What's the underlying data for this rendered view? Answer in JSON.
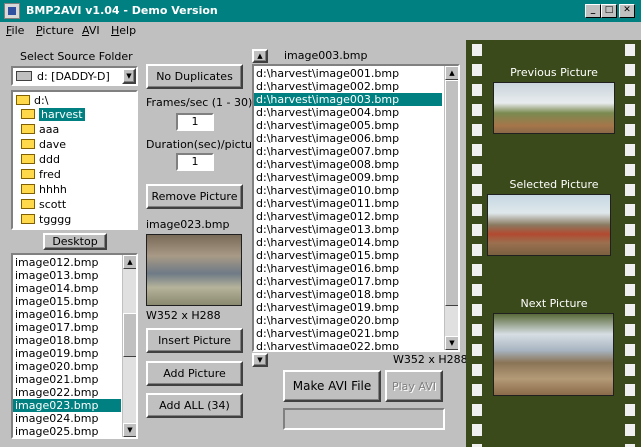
{
  "window": {
    "title": "BMP2AVI v1.04 - Demo Version",
    "min": "_",
    "max": "□",
    "close": "✕"
  },
  "menu": [
    "File",
    "Picture",
    "AVI",
    "Help"
  ],
  "source": {
    "label": "Select Source Folder",
    "drive": "d: [DADDY-D]",
    "tree": [
      {
        "name": "d:\\",
        "level": 0,
        "selected": false,
        "open": true
      },
      {
        "name": "harvest",
        "level": 1,
        "selected": true,
        "open": true
      },
      {
        "name": "aaa",
        "level": 1,
        "selected": false
      },
      {
        "name": "dave",
        "level": 1,
        "selected": false
      },
      {
        "name": "ddd",
        "level": 1,
        "selected": false
      },
      {
        "name": "fred",
        "level": 1,
        "selected": false
      },
      {
        "name": "hhhh",
        "level": 1,
        "selected": false
      },
      {
        "name": "scott",
        "level": 1,
        "selected": false
      },
      {
        "name": "tgggg",
        "level": 1,
        "selected": false
      }
    ],
    "desktop_label": "Desktop",
    "files": [
      "image012.bmp",
      "image013.bmp",
      "image014.bmp",
      "image015.bmp",
      "image016.bmp",
      "image017.bmp",
      "image018.bmp",
      "image019.bmp",
      "image020.bmp",
      "image021.bmp",
      "image022.bmp",
      "image023.bmp",
      "image024.bmp",
      "image025.bmp"
    ],
    "files_selected_index": 11
  },
  "controls": {
    "no_duplicates": "No Duplicates",
    "fps_label": "Frames/sec (1 - 30)",
    "fps_value": "1",
    "duration_label": "Duration(sec)/picture",
    "duration_value": "1",
    "remove_picture": "Remove Picture",
    "preview_name": "image023.bmp",
    "preview_size": "W352 x H288",
    "insert_picture": "Insert Picture",
    "add_picture": "Add Picture",
    "add_all": "Add ALL (34)"
  },
  "sequence": {
    "current_name": "image003.bmp",
    "items": [
      "d:\\harvest\\image001.bmp",
      "d:\\harvest\\image002.bmp",
      "d:\\harvest\\image003.bmp",
      "d:\\harvest\\image004.bmp",
      "d:\\harvest\\image005.bmp",
      "d:\\harvest\\image006.bmp",
      "d:\\harvest\\image007.bmp",
      "d:\\harvest\\image008.bmp",
      "d:\\harvest\\image009.bmp",
      "d:\\harvest\\image010.bmp",
      "d:\\harvest\\image011.bmp",
      "d:\\harvest\\image012.bmp",
      "d:\\harvest\\image013.bmp",
      "d:\\harvest\\image014.bmp",
      "d:\\harvest\\image015.bmp",
      "d:\\harvest\\image016.bmp",
      "d:\\harvest\\image017.bmp",
      "d:\\harvest\\image018.bmp",
      "d:\\harvest\\image019.bmp",
      "d:\\harvest\\image020.bmp",
      "d:\\harvest\\image021.bmp",
      "d:\\harvest\\image022.bmp"
    ],
    "selected_index": 2,
    "size": "W352 x H288",
    "make_avi": "Make AVI File",
    "play_avi": "Play AVI"
  },
  "film": {
    "previous": "Previous Picture",
    "selected": "Selected Picture",
    "next": "Next Picture"
  },
  "colors": {
    "title_bar": "#008080",
    "selection": "#008080",
    "film": "#3a4a1a"
  }
}
